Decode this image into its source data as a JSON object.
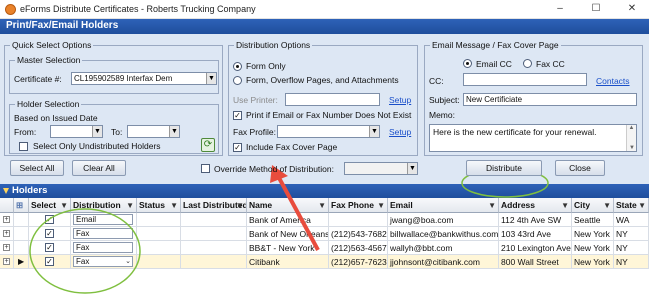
{
  "window": {
    "title": "eForms Distribute Certificates - Roberts Trucking Company",
    "controls": {
      "minimize": "–",
      "maximize": "☐",
      "close": "✕"
    }
  },
  "header": {
    "title": "Print/Fax/Email Holders"
  },
  "quick_select": {
    "legend": "Quick Select Options",
    "master_legend": "Master Selection",
    "certificate_label": "Certificate #:",
    "certificate_value": "CL195902589 Interfax Dem",
    "holder_legend": "Holder Selection",
    "based_on": "Based on Issued Date",
    "from_label": "From:",
    "to_label": "To:",
    "undistributed_label": "Select Only Undistributed Holders",
    "undistributed_checked": false
  },
  "distribution_options": {
    "legend": "Distribution Options",
    "radio_form_only": "Form Only",
    "radio_form_overflow": "Form, Overflow Pages, and Attachments",
    "selected": "Form Only",
    "use_printer_label": "Use Printer:",
    "setup_link": "Setup",
    "print_if_missing_label": "Print if Email or Fax Number Does Not Exist",
    "print_if_missing_checked": true,
    "fax_profile_label": "Fax Profile:",
    "fax_setup_link": "Setup",
    "include_cover_label": "Include Fax Cover Page",
    "include_cover_checked": true
  },
  "email_message": {
    "legend": "Email Message / Fax Cover Page",
    "radio_email_cc": "Email CC",
    "radio_fax_cc": "Fax CC",
    "selected": "Email CC",
    "cc_label": "CC:",
    "contacts_link": "Contacts",
    "subject_label": "Subject:",
    "subject_value": "New Certificiate",
    "memo_label": "Memo:",
    "memo_value": "Here is the new certificate for your renewal."
  },
  "actions": {
    "select_all": "Select All",
    "clear_all": "Clear All",
    "override_label": "Override Method of Distribution:",
    "distribute": "Distribute",
    "close": "Close"
  },
  "holders": {
    "title": "Holders",
    "columns": [
      "Select",
      "Distribution",
      "Status",
      "Last Distributed",
      "Name",
      "Fax Phone",
      "Email",
      "Address",
      "City",
      "State"
    ],
    "rows": [
      {
        "select": true,
        "distribution": "Email",
        "status": "",
        "last_distributed": "",
        "name": "Bank of America",
        "fax": "",
        "email": "jwang@boa.com",
        "address": "112 4th Ave SW",
        "city": "Seattle",
        "state": "WA"
      },
      {
        "select": true,
        "distribution": "Fax",
        "status": "",
        "last_distributed": "",
        "name": "Bank of New Orleans",
        "fax": "(212)543-7682",
        "email": "billwallace@bankwithus.com",
        "address": "103 43rd Ave",
        "city": "New York",
        "state": "NY"
      },
      {
        "select": true,
        "distribution": "Fax",
        "status": "",
        "last_distributed": "",
        "name": "BB&T - New York",
        "fax": "(212)563-4567",
        "email": "wallyh@bbt.com",
        "address": "210 Lexington Ave",
        "city": "New York",
        "state": "NY"
      },
      {
        "select": true,
        "distribution": "Fax",
        "status": "",
        "last_distributed": "",
        "name": "Citibank",
        "fax": "(212)657-7623",
        "email": "jjohnsont@citibank.com",
        "address": "800 Wall Street",
        "city": "New York",
        "state": "NY"
      }
    ]
  },
  "colors": {
    "header_blue": "#1f4e9c",
    "panel_bg": "#dde7f4",
    "highlight_green": "#7fbf3f",
    "arrow_red": "#e84c3d"
  }
}
